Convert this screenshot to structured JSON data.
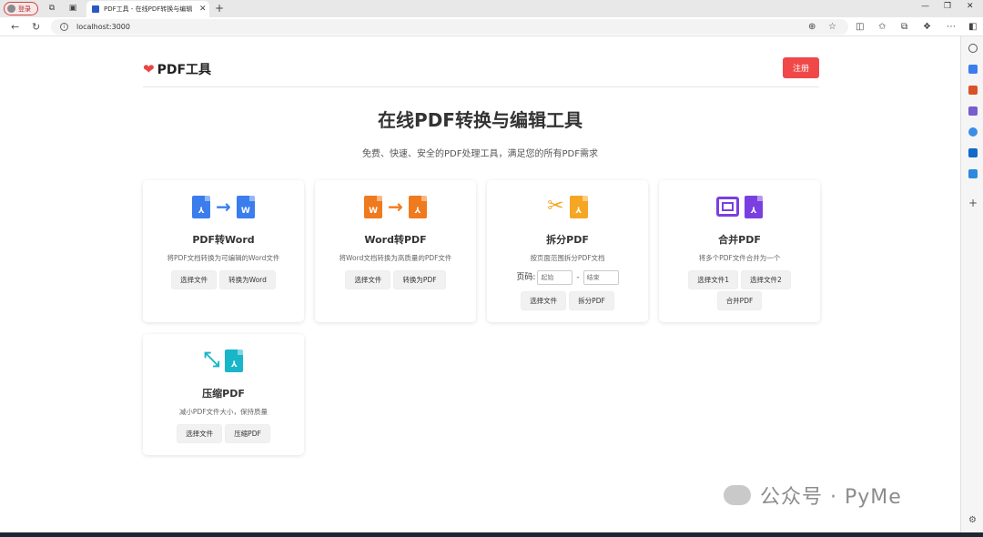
{
  "browser": {
    "profile_label": "登录",
    "tab_title": "PDF工具 - 在线PDF转换与编辑",
    "url": "localhost:3000"
  },
  "header": {
    "logo_text": "PDF工具",
    "register_label": "注册"
  },
  "hero": {
    "title": "在线PDF转换与编辑工具",
    "subtitle": "免费、快速、安全的PDF处理工具，满足您的所有PDF需求"
  },
  "tools": [
    {
      "title": "PDF转Word",
      "description": "将PDF文档转换为可编辑的Word文件",
      "buttons": [
        "选择文件",
        "转换为Word"
      ],
      "icons": [
        "pdf-icon",
        "arrow-right-icon",
        "word-icon"
      ]
    },
    {
      "title": "Word转PDF",
      "description": "将Word文档转换为高质量的PDF文件",
      "buttons": [
        "选择文件",
        "转换为PDF"
      ],
      "icons": [
        "word-icon",
        "arrow-right-icon",
        "pdf-icon"
      ]
    },
    {
      "title": "拆分PDF",
      "description": "按页面范围拆分PDF文档",
      "page_label": "页码:",
      "start_placeholder": "起始",
      "end_placeholder": "结束",
      "range_separator": "-",
      "buttons": [
        "选择文件",
        "拆分PDF"
      ],
      "icons": [
        "scissors-icon",
        "pdf-icon"
      ]
    },
    {
      "title": "合并PDF",
      "description": "将多个PDF文件合并为一个",
      "buttons": [
        "选择文件1",
        "选择文件2",
        "合并PDF"
      ],
      "icons": [
        "merge-frame-icon",
        "pdf-icon"
      ]
    },
    {
      "title": "压缩PDF",
      "description": "减小PDF文件大小，保持质量",
      "buttons": [
        "选择文件",
        "压缩PDF"
      ],
      "icons": [
        "compress-icon",
        "pdf-icon"
      ]
    }
  ],
  "watermark": "公众号 · PyMe",
  "colors": {
    "blue": "#3b7ded",
    "orange": "#f07a1e",
    "amber": "#f5a623",
    "purple": "#7a3fe0",
    "teal": "#19b6c9",
    "register_red": "#f04848"
  }
}
